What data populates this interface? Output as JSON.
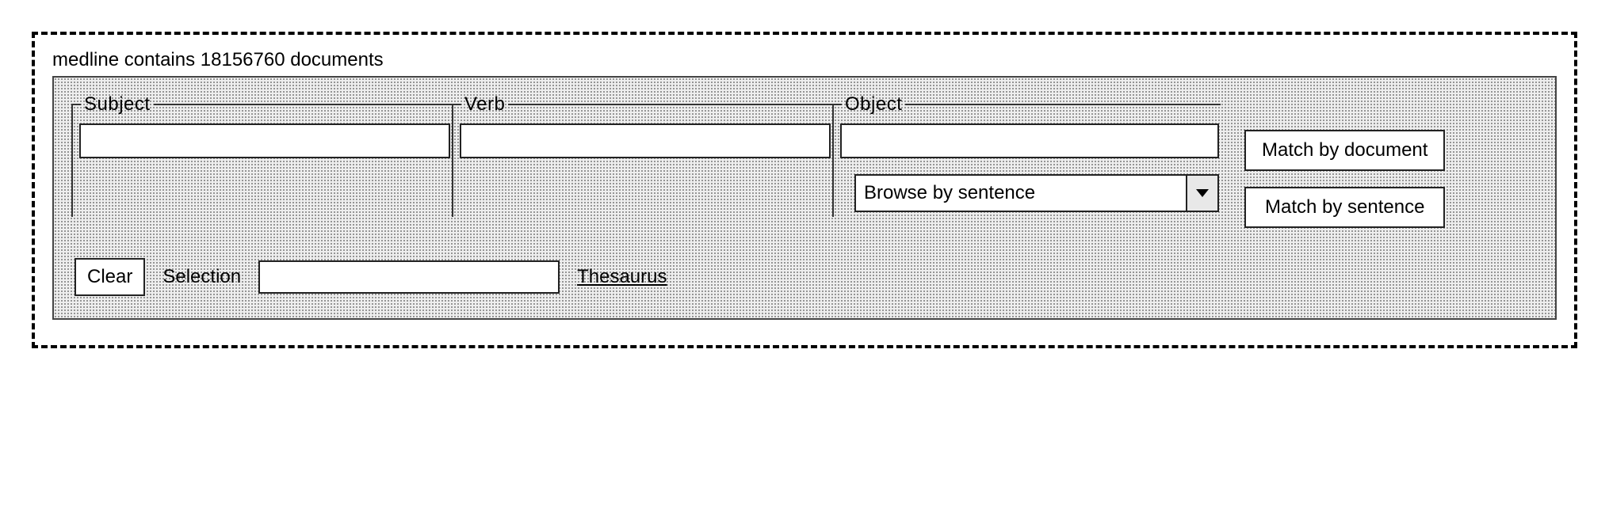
{
  "status_line": "medline contains 18156760 documents",
  "fields": {
    "subject": {
      "label": "Subject",
      "value": ""
    },
    "verb": {
      "label": "Verb",
      "value": ""
    },
    "object": {
      "label": "Object",
      "value": ""
    }
  },
  "browse_select": {
    "selected": "Browse by sentence"
  },
  "buttons": {
    "match_document": "Match by document",
    "match_sentence": "Match by sentence",
    "clear": "Clear"
  },
  "selection": {
    "label": "Selection",
    "value": ""
  },
  "thesaurus_link": "Thesaurus"
}
